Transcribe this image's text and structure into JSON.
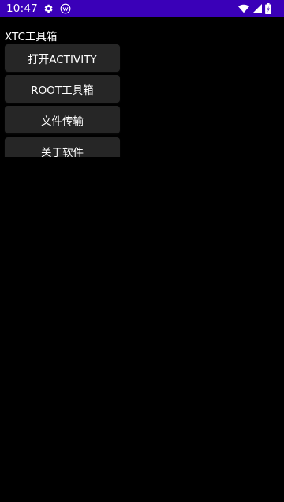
{
  "status_bar": {
    "time": "10:47",
    "background": "#3a00b8",
    "left_icons": [
      "gear-icon",
      "app-notification-icon"
    ],
    "right_icons": [
      "wifi-icon",
      "signal-icon",
      "battery-icon"
    ]
  },
  "app": {
    "title": "XTC工具箱",
    "background": "#000000"
  },
  "menu": {
    "open_activity_label": "打开ACTIVITY",
    "root_toolbox_label": "ROOT工具箱",
    "file_transfer_label": "文件传输",
    "about_label": "关于软件",
    "button_color": "#262626"
  }
}
